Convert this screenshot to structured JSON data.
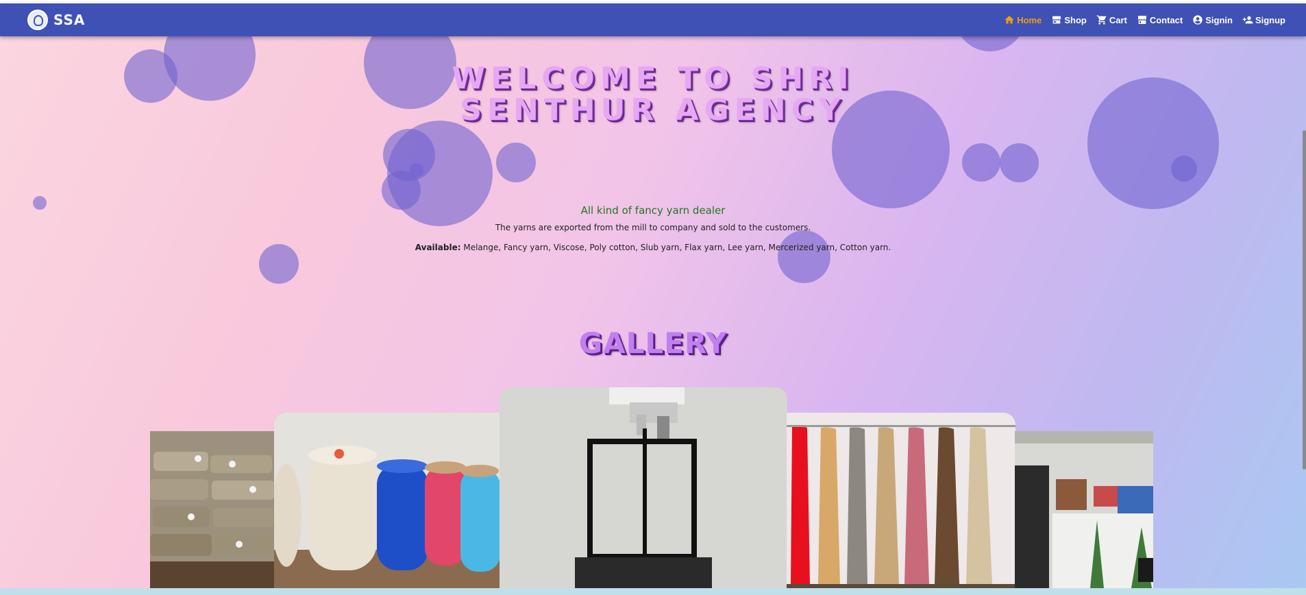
{
  "brand": {
    "name": "SSA"
  },
  "nav": {
    "items": [
      {
        "label": "Home",
        "icon": "home-icon",
        "active": true
      },
      {
        "label": "Shop",
        "icon": "store-icon",
        "active": false
      },
      {
        "label": "Cart",
        "icon": "cart-icon",
        "active": false
      },
      {
        "label": "Contact",
        "icon": "storefront-icon",
        "active": false
      },
      {
        "label": "Signin",
        "icon": "account-circle-icon",
        "active": false
      },
      {
        "label": "Signup",
        "icon": "person-add-icon",
        "active": false
      }
    ],
    "active_color": "#f39c12"
  },
  "hero": {
    "title_line1": "WELCOME TO SHRI",
    "title_line2": "SENTHUR AGENCY",
    "tagline": "All kind of fancy yarn dealer",
    "description": "The yarns are exported from the mill to company and sold to the customers.",
    "available_label": "Available:",
    "available_list": "Melange, Fancy yarn, Viscose, Poly cotton, Slub yarn, Flax yarn, Lee yarn, Mercerized yarn, Cotton yarn."
  },
  "gallery": {
    "title": "GALLERY",
    "images": [
      "yarn-sacks-photo",
      "yarn-cones-photo",
      "yarn-testing-machine-photo",
      "yarn-samples-photo",
      "shop-front-photo"
    ]
  },
  "colors": {
    "navbar": "#3f51b5",
    "bubble": "#6e60ce",
    "title_fill": "#e5a8f2",
    "tagline": "#1d7a1d"
  }
}
